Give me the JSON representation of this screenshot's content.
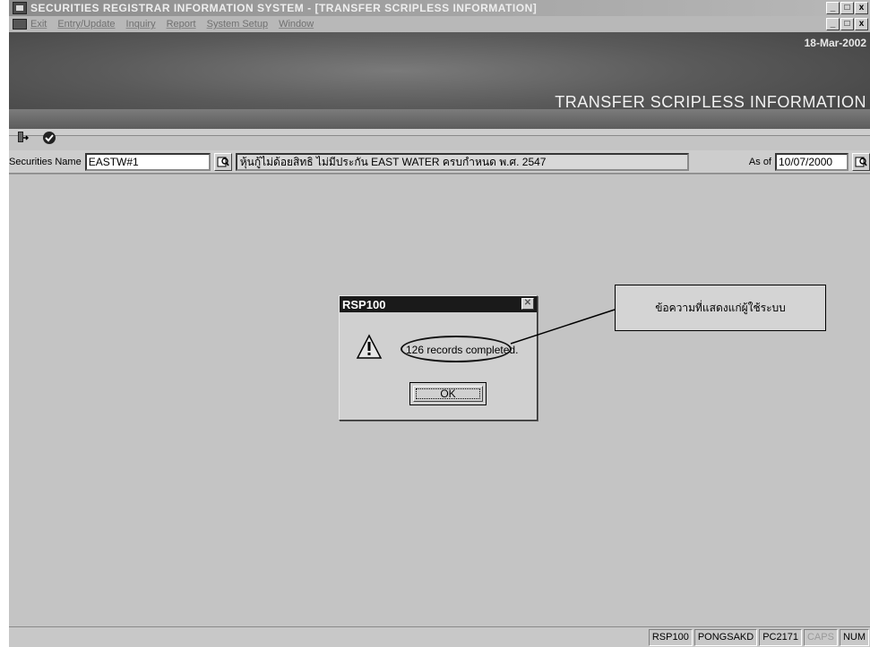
{
  "window": {
    "title": "SECURITIES REGISTRAR INFORMATION SYSTEM - [TRANSFER SCRIPLESS INFORMATION]",
    "min_label": "_",
    "max_label": "□",
    "close_label": "x"
  },
  "menu": {
    "items": [
      {
        "label": "Exit"
      },
      {
        "label": "Entry/Update"
      },
      {
        "label": "Inquiry"
      },
      {
        "label": "Report"
      },
      {
        "label": "System Setup"
      },
      {
        "label": "Window"
      }
    ]
  },
  "banner": {
    "date": "18-Mar-2002",
    "screen_title": "TRANSFER SCRIPLESS INFORMATION"
  },
  "toolbar": {
    "icons": [
      "exit-door-icon",
      "check-icon"
    ]
  },
  "criteria": {
    "securities_label": "Securities Name",
    "securities_value": "EASTW#1",
    "description": "หุ้นกู้ไม่ด้อยสิทธิ ไม่มีประกัน EAST WATER ครบกำหนด พ.ศ. 2547",
    "as_of_label": "As of",
    "as_of_value": "10/07/2000"
  },
  "dialog": {
    "title": "RSP100",
    "message": "126 records completed.",
    "ok_label": "OK",
    "icon": "warning-icon"
  },
  "callout": {
    "text": "ข้อความที่แสดงแก่ผู้ใช้ระบบ"
  },
  "status": {
    "program": "RSP100",
    "user": "PONGSAKD",
    "machine": "PC2171",
    "caps": "CAPS",
    "num": "NUM"
  }
}
